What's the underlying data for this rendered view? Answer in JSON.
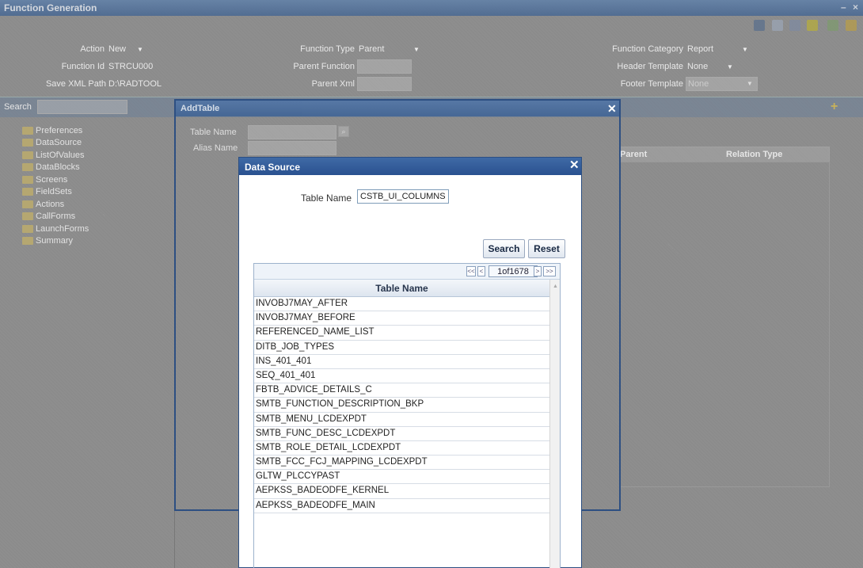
{
  "window": {
    "title": "Function Generation"
  },
  "toolbar": {
    "icons": [
      "save-icon",
      "delete-icon",
      "list-icon",
      "generate-icon",
      "settings-icon",
      "exit-icon"
    ]
  },
  "header": {
    "action_label": "Action",
    "action_value": "New",
    "function_id_label": "Function Id",
    "function_id_value": "STRCU000",
    "save_xml_label": "Save XML Path",
    "save_xml_value": "D:\\RADTOOL",
    "function_type_label": "Function Type",
    "function_type_value": "Parent",
    "parent_function_label": "Parent Function",
    "parent_xml_label": "Parent Xml",
    "function_category_label": "Function Category",
    "function_category_value": "Report",
    "header_template_label": "Header Template",
    "header_template_value": "None",
    "footer_template_label": "Footer Template",
    "footer_template_value": "None"
  },
  "sidebar": {
    "search_label": "Search",
    "items": [
      "Preferences",
      "DataSource",
      "ListOfValues",
      "DataBlocks",
      "Screens",
      "FieldSets",
      "Actions",
      "CallForms",
      "LaunchForms",
      "Summary"
    ]
  },
  "grid": {
    "col_parent": "Parent",
    "col_relation": "Relation Type"
  },
  "add_table": {
    "title": "AddTable",
    "table_name_label": "Table Name",
    "alias_name_label": "Alias Name",
    "lov_label": "⌕"
  },
  "data_source": {
    "title": "Data Source",
    "table_name_label": "Table Name",
    "table_name_value": "CSTB_UI_COLUMNS",
    "search_button": "Search",
    "reset_button": "Reset",
    "pager": {
      "first": "<<",
      "prev": "<",
      "page_text": "1of1678",
      "next": ">",
      "last": ">>"
    },
    "column_header": "Table Name",
    "rows": [
      "INVOBJ7MAY_AFTER",
      "INVOBJ7MAY_BEFORE",
      "REFERENCED_NAME_LIST",
      "DITB_JOB_TYPES",
      "INS_401_401",
      "SEQ_401_401",
      "FBTB_ADVICE_DETAILS_C",
      "SMTB_FUNCTION_DESCRIPTION_BKP",
      "SMTB_MENU_LCDEXPDT",
      "SMTB_FUNC_DESC_LCDEXPDT",
      "SMTB_ROLE_DETAIL_LCDEXPDT",
      "SMTB_FCC_FCJ_MAPPING_LCDEXPDT",
      "GLTW_PLCCYPAST",
      "AEPKSS_BADEODFE_KERNEL",
      "AEPKSS_BADEODFE_MAIN"
    ]
  },
  "colors": {
    "dialog_bar": "#2a5190",
    "overlay": "#8e8e8e"
  }
}
